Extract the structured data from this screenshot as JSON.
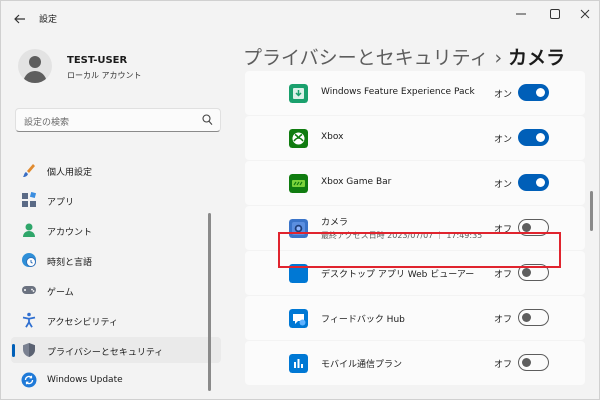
{
  "titlebar": {
    "app_title": "設定"
  },
  "user": {
    "name": "TEST-USER",
    "account_type": "ローカル アカウント"
  },
  "search": {
    "placeholder": "設定の検索"
  },
  "sidebar": {
    "items": [
      {
        "label": "個人用設定",
        "icon": "brush-icon"
      },
      {
        "label": "アプリ",
        "icon": "apps-icon"
      },
      {
        "label": "アカウント",
        "icon": "account-icon"
      },
      {
        "label": "時刻と言語",
        "icon": "globe-clock-icon"
      },
      {
        "label": "ゲーム",
        "icon": "gamepad-icon"
      },
      {
        "label": "アクセシビリティ",
        "icon": "accessibility-icon"
      },
      {
        "label": "プライバシーとセキュリティ",
        "icon": "shield-icon",
        "selected": true
      },
      {
        "label": "Windows Update",
        "icon": "update-icon"
      }
    ]
  },
  "breadcrumb": {
    "parent": "プライバシーとセキュリティ",
    "separator": "›",
    "current": "カメラ"
  },
  "apps": [
    {
      "name": "Windows Feature Experience Pack",
      "state": "オン",
      "on": true,
      "icon": "feature-pack-icon",
      "icon_color": "#1aa06d"
    },
    {
      "name": "Xbox",
      "state": "オン",
      "on": true,
      "icon": "xbox-icon",
      "icon_color": "#107c10"
    },
    {
      "name": "Xbox Game Bar",
      "state": "オン",
      "on": true,
      "icon": "game-bar-icon",
      "icon_color": "#107c10"
    },
    {
      "name": "カメラ",
      "subtitle": "最終アクセス日時 2023/07/07 ｜ 17:49:35",
      "state": "オフ",
      "on": false,
      "icon": "camera-icon",
      "icon_color": "#3a74c9"
    },
    {
      "name": "デスクトップ アプリ Web ビューアー",
      "state": "オフ",
      "on": false,
      "icon": "web-viewer-icon",
      "icon_color": "#0078d4"
    },
    {
      "name": "フィードバック Hub",
      "state": "オフ",
      "on": false,
      "icon": "feedback-hub-icon",
      "icon_color": "#0078d4"
    },
    {
      "name": "モバイル通信プラン",
      "state": "オフ",
      "on": false,
      "icon": "mobile-plans-icon",
      "icon_color": "#0078d4"
    }
  ],
  "colors": {
    "accent": "#005fb8",
    "highlight": "#e0242e"
  }
}
